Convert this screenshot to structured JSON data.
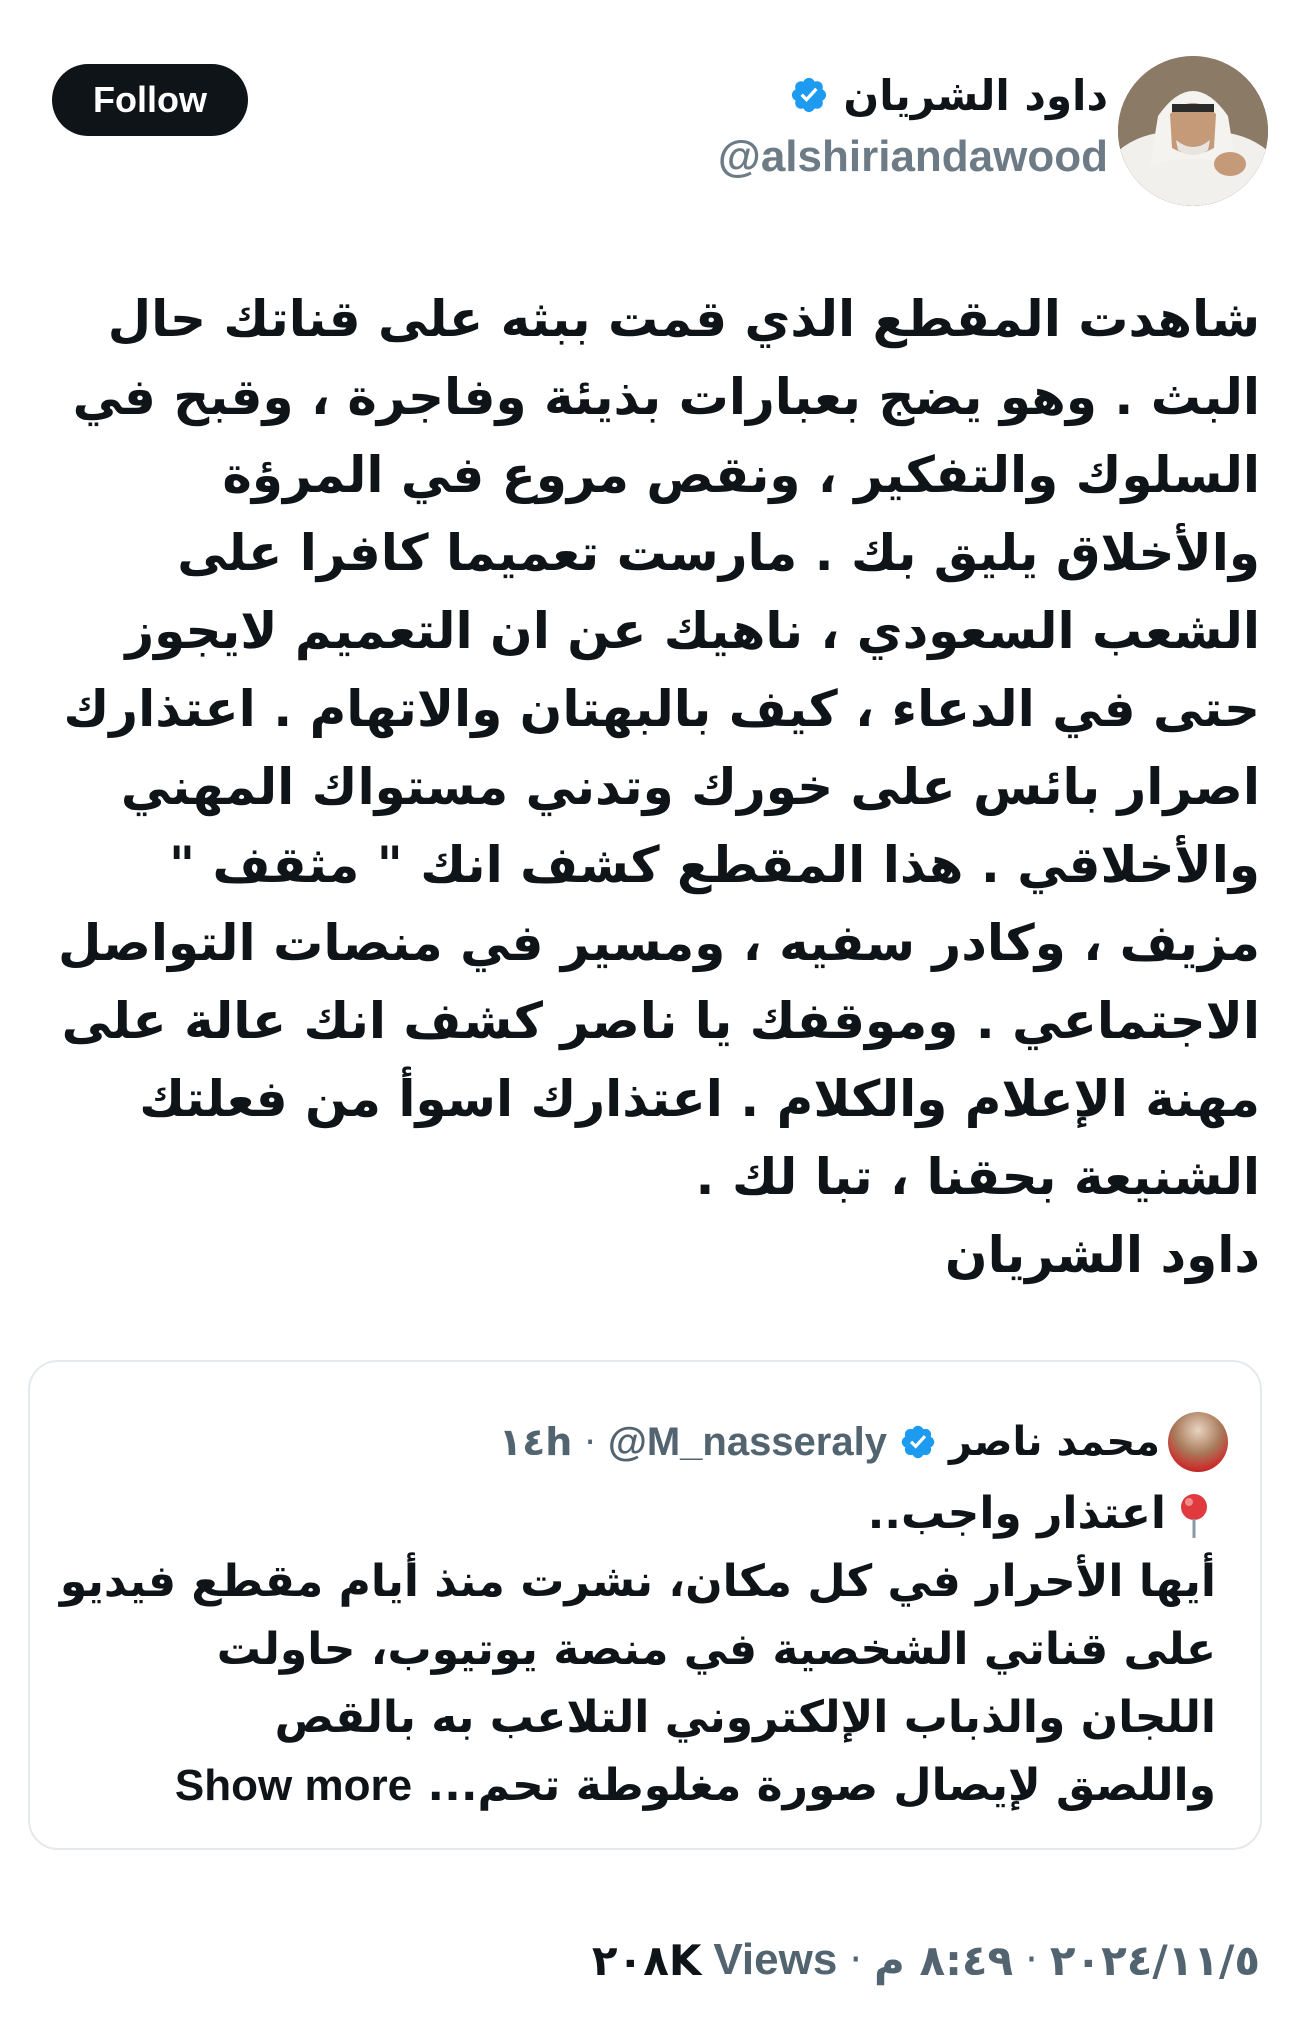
{
  "header": {
    "follow_label": "Follow",
    "author_name": "داود الشريان",
    "author_handle": "@alshiriandawood",
    "verified_color": "#1d9bf0",
    "verified_icon": "verified-badge-icon"
  },
  "tweet": {
    "text": "شاهدت المقطع الذي قمت ببثه على قناتك حال البث . وهو يضج بعبارات بذيئة وفاجرة  ، وقبح في السلوك والتفكير ، ونقص مروع في المرؤة والأخلاق يليق بك  . مارست تعميما كافرا على الشعب السعودي ، ناهيك عن ان التعميم لايجوز حتى في الدعاء ، كيف بالبهتان والاتهام . اعتذارك اصرار بائس على خورك وتدني مستواك المهني والأخلاقي  . هذا المقطع كشف انك \" مثقف \" مزيف ، وكادر سفيه  ، ومسير  في منصات التواصل الاجتماعي . وموقفك يا ناصر كشف انك عالة على مهنة الإعلام والكلام . اعتذارك اسوأ من فعلتك الشنيعة بحقنا ، تبا لك .\nداود الشريان"
  },
  "quote": {
    "author_name": "محمد ناصر",
    "author_handle": "@M_nasseraly",
    "separator": "·",
    "time": "١٤h",
    "pin_icon": "pushpin-icon",
    "lines": [
      "اعتذار واجب..",
      "أيها الأحرار في كل مكان، نشرت منذ أيام مقطع فيديو",
      "على قناتي الشخصية في منصة يوتيوب، حاولت",
      "اللجان والذباب الإلكتروني التلاعب به بالقص",
      "واللصق لإيصال صورة مغلوطة تحم..."
    ],
    "show_more": "Show more"
  },
  "meta": {
    "date": "٢٠٢٤/١١/٥",
    "time": "٨:٤٩ م",
    "separator": "·",
    "views_count": "٢٠٨K",
    "views_label": "Views"
  }
}
